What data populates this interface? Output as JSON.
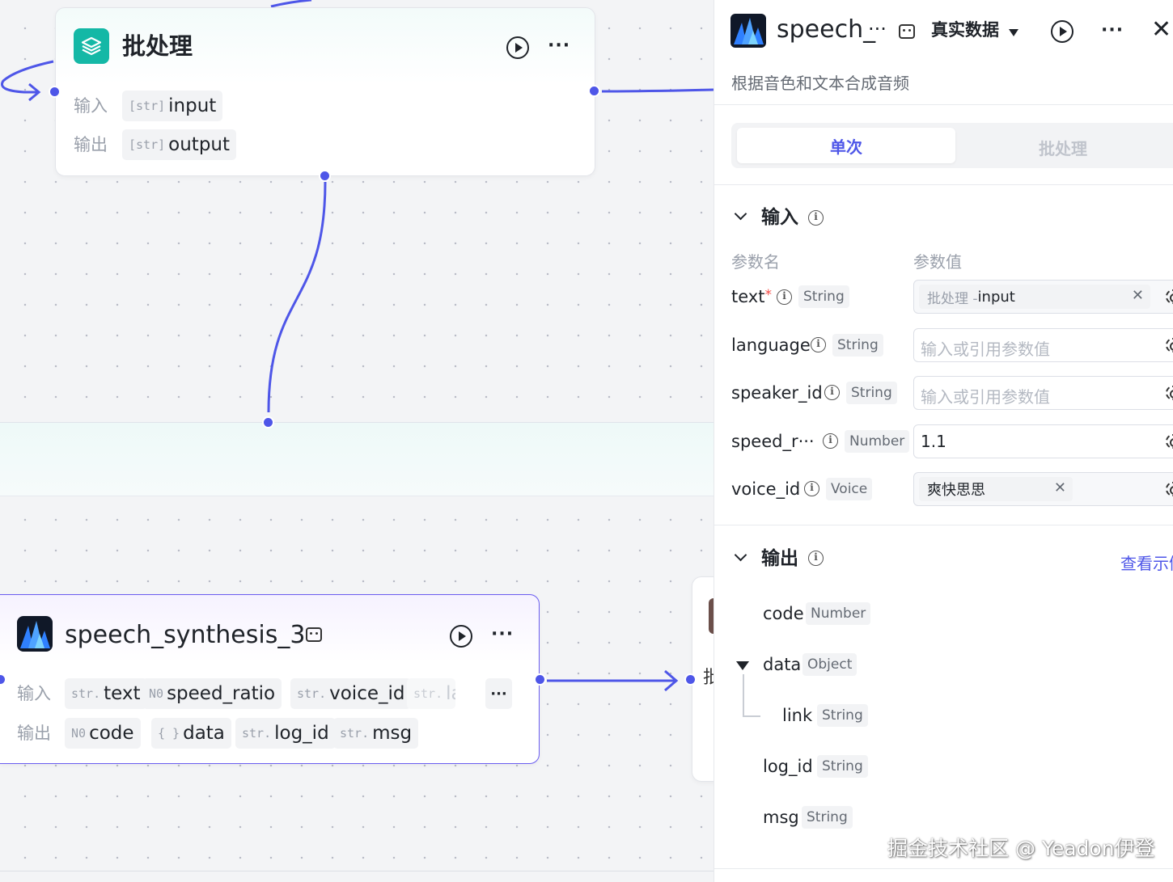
{
  "canvas": {
    "batch_node": {
      "title": "批处理",
      "input_label": "输入",
      "output_label": "输出",
      "input_param": {
        "type": "[str]",
        "name": "input"
      },
      "output_param": {
        "type": "[str]",
        "name": "output"
      }
    },
    "speech_node": {
      "title": "speech_synthesis_3",
      "input_label": "输入",
      "output_label": "输出",
      "inputs": [
        {
          "type": "str.",
          "name": "text"
        },
        {
          "type": "N0",
          "name": "speed_ratio"
        },
        {
          "type": "str.",
          "name": "voice_id"
        },
        {
          "type": "str.",
          "name": "la"
        }
      ],
      "more_label": "···",
      "outputs": [
        {
          "type": "N0",
          "name": "code"
        },
        {
          "type": "{ }",
          "name": "data"
        },
        {
          "type": "str.",
          "name": "log_id"
        },
        {
          "type": "str.",
          "name": "msg"
        }
      ]
    },
    "partial_node_char": "批"
  },
  "panel": {
    "title": "speech_",
    "title_ellipsis": "···",
    "mode_label": "真实数据",
    "description": "根据音色和文本合成音频",
    "tabs": {
      "single": "单次",
      "batch": "批处理"
    },
    "input_section": {
      "title": "输入",
      "col_name": "参数名",
      "col_value": "参数值",
      "params": [
        {
          "name": "text",
          "required": "*",
          "type": "String",
          "ref_node": "批处理 - ",
          "ref_field": "input"
        },
        {
          "name": "language",
          "type": "String",
          "placeholder": "输入或引用参数值"
        },
        {
          "name": "speaker_id",
          "type": "String",
          "placeholder": "输入或引用参数值"
        },
        {
          "name": "speed_r···",
          "type": "Number",
          "value": "1.1"
        },
        {
          "name": "voice_id",
          "type": "Voice",
          "chip": "爽快思思"
        }
      ]
    },
    "output_section": {
      "title": "输出",
      "view_link": "查看示例",
      "fields": [
        {
          "name": "code",
          "type": "Number"
        },
        {
          "name": "data",
          "type": "Object"
        },
        {
          "name": "link",
          "type": "String"
        },
        {
          "name": "log_id",
          "type": "String"
        },
        {
          "name": "msg",
          "type": "String"
        }
      ]
    }
  },
  "watermark": "掘金技术社区 @ Yeadon伊登",
  "colors": {
    "accent": "#4e56e8",
    "batch_icon": "#14b8a6",
    "required": "#f54a45"
  }
}
